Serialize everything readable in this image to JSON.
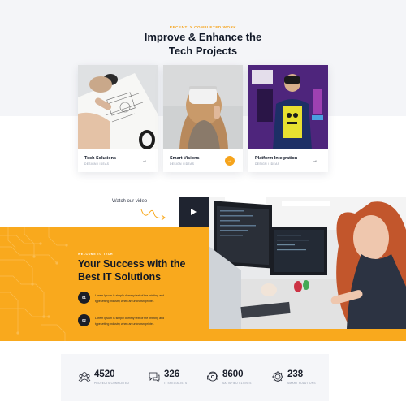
{
  "section": {
    "eyebrow": "RECENTLY COMPLETED WORK",
    "title_line1": "Improve & Enhance the",
    "title_line2": "Tech Projects"
  },
  "projects": [
    {
      "title": "Tech Solutions",
      "subtitle": "DESIGN / IDEAS",
      "arrow": "→",
      "active": false
    },
    {
      "title": "Smart Visions",
      "subtitle": "DESIGN / IDEAS",
      "arrow": "→",
      "active": true
    },
    {
      "title": "Platform Integration",
      "subtitle": "DESIGN / IDEAS",
      "arrow": "→",
      "active": false
    }
  ],
  "video": {
    "watch_label": "Watch our video",
    "play_icon": "play-icon"
  },
  "about": {
    "eyebrow": "WELCOME TO TECH",
    "title_line1": "Your Success with the",
    "title_line2": "Best IT Solutions",
    "steps": [
      {
        "num": "01",
        "line1": "Lorem Ipsum is simply dummy text of the printing and",
        "line2": "typesetting industry when an unknown printer."
      },
      {
        "num": "02",
        "line1": "Lorem Ipsum is simply dummy text of the printing and",
        "line2": "typesetting industry when an unknown printer."
      }
    ]
  },
  "stats": [
    {
      "value": "4520",
      "label": "PROJECTS COMPLETED",
      "icon": "team-icon"
    },
    {
      "value": "326",
      "label": "IT SPECIALISTS",
      "icon": "chat-icon"
    },
    {
      "value": "8600",
      "label": "SATISFIED CLIENTS",
      "icon": "support-icon"
    },
    {
      "value": "238",
      "label": "SMART SOLUTIONS",
      "icon": "gear-icon"
    }
  ],
  "colors": {
    "accent": "#f9a91d",
    "dark": "#1a1d27",
    "light_bg": "#f4f5f8"
  }
}
